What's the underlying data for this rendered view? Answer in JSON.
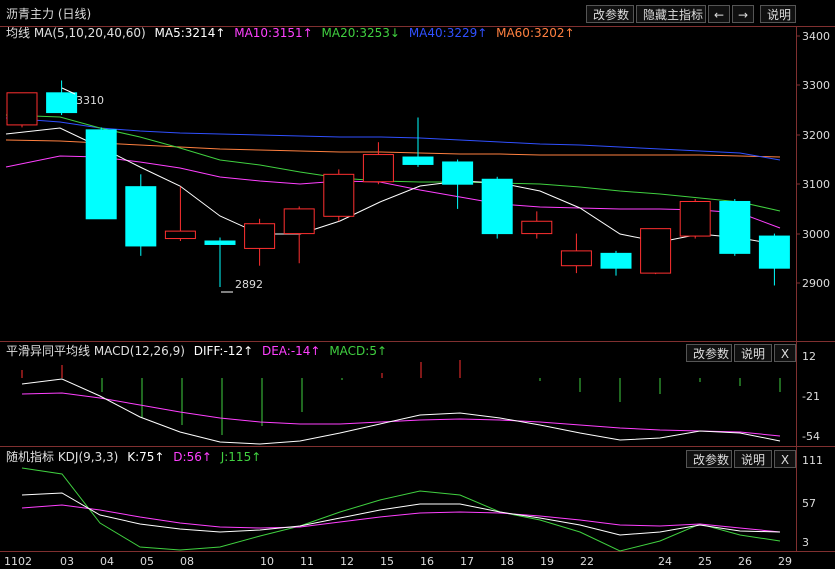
{
  "app": {
    "title": "沥青主力 (日线)",
    "buttons": {
      "params": "改参数",
      "hide": "隐藏主指标",
      "prev": "←",
      "next": "→",
      "help": "说明"
    }
  },
  "main_panel": {
    "legend": [
      {
        "text": "均线 MA(5,10,20,40,60)",
        "color": "#e0e0e0"
      },
      {
        "text": "MA5:3214↑",
        "color": "#ffffff"
      },
      {
        "text": "MA10:3151↑",
        "color": "#ff40ff"
      },
      {
        "text": "MA20:3253↓",
        "color": "#40d040"
      },
      {
        "text": "MA40:3229↑",
        "color": "#3050ff"
      },
      {
        "text": "MA60:3202↑",
        "color": "#ff8040"
      }
    ],
    "axis_labels": [
      "3400",
      "3300",
      "3200",
      "3100",
      "3000",
      "2900"
    ],
    "annotations": {
      "high": "3310",
      "low": "2892"
    }
  },
  "macd_panel": {
    "legend": [
      {
        "text": "平滑异同平均线 MACD(12,26,9)",
        "color": "#e0e0e0"
      },
      {
        "text": "DIFF:-12↑",
        "color": "#ffffff"
      },
      {
        "text": "DEA:-14↑",
        "color": "#ff40ff"
      },
      {
        "text": "MACD:5↑",
        "color": "#40d040"
      }
    ],
    "buttons": {
      "params": "改参数",
      "help": "说明",
      "close": "X"
    },
    "axis_labels": [
      "12",
      "-21",
      "-54"
    ]
  },
  "kdj_panel": {
    "legend": [
      {
        "text": "随机指标 KDJ(9,3,3)",
        "color": "#e0e0e0"
      },
      {
        "text": "K:75↑",
        "color": "#ffffff"
      },
      {
        "text": "D:56↑",
        "color": "#ff40ff"
      },
      {
        "text": "J:115↑",
        "color": "#40d040"
      }
    ],
    "buttons": {
      "params": "改参数",
      "help": "说明",
      "close": "X"
    },
    "axis_labels": [
      "111",
      "57",
      "3"
    ]
  },
  "dates": [
    "1102",
    "03",
    "04",
    "05",
    "08",
    "10",
    "11",
    "12",
    "15",
    "16",
    "17",
    "18",
    "19",
    "22",
    "24",
    "25",
    "26",
    "29"
  ],
  "colors": {
    "up": "#ff3030",
    "down": "#00ffff",
    "border": "#800000"
  },
  "chart_data": {
    "type": "candlestick",
    "ylim": [
      2840,
      3420
    ],
    "candles": [
      {
        "o": 3220,
        "h": 3285,
        "l": 3215,
        "c": 3285
      },
      {
        "o": 3285,
        "h": 3310,
        "l": 3240,
        "c": 3245
      },
      {
        "o": 3210,
        "h": 3215,
        "l": 3030,
        "c": 3030
      },
      {
        "o": 3095,
        "h": 3120,
        "l": 2955,
        "c": 2975
      },
      {
        "o": 2990,
        "h": 3095,
        "l": 2985,
        "c": 3005
      },
      {
        "o": 2985,
        "h": 2992,
        "l": 2892,
        "c": 2978
      },
      {
        "o": 2970,
        "h": 3030,
        "l": 2935,
        "c": 3020
      },
      {
        "o": 3000,
        "h": 3055,
        "l": 2940,
        "c": 3050
      },
      {
        "o": 3035,
        "h": 3130,
        "l": 3025,
        "c": 3120
      },
      {
        "o": 3105,
        "h": 3185,
        "l": 3100,
        "c": 3160
      },
      {
        "o": 3155,
        "h": 3235,
        "l": 3135,
        "c": 3140
      },
      {
        "o": 3145,
        "h": 3150,
        "l": 3050,
        "c": 3100
      },
      {
        "o": 3110,
        "h": 3115,
        "l": 2990,
        "c": 3000
      },
      {
        "o": 3000,
        "h": 3045,
        "l": 2990,
        "c": 3025
      },
      {
        "o": 2935,
        "h": 3000,
        "l": 2920,
        "c": 2965
      },
      {
        "o": 2960,
        "h": 2965,
        "l": 2915,
        "c": 2930
      },
      {
        "o": 2920,
        "h": 3010,
        "l": 2918,
        "c": 3010
      },
      {
        "o": 2995,
        "h": 3070,
        "l": 2990,
        "c": 3065
      },
      {
        "o": 3065,
        "h": 3070,
        "l": 2955,
        "c": 2960
      },
      {
        "o": 2995,
        "h": 3000,
        "l": 2895,
        "c": 2930
      }
    ]
  }
}
